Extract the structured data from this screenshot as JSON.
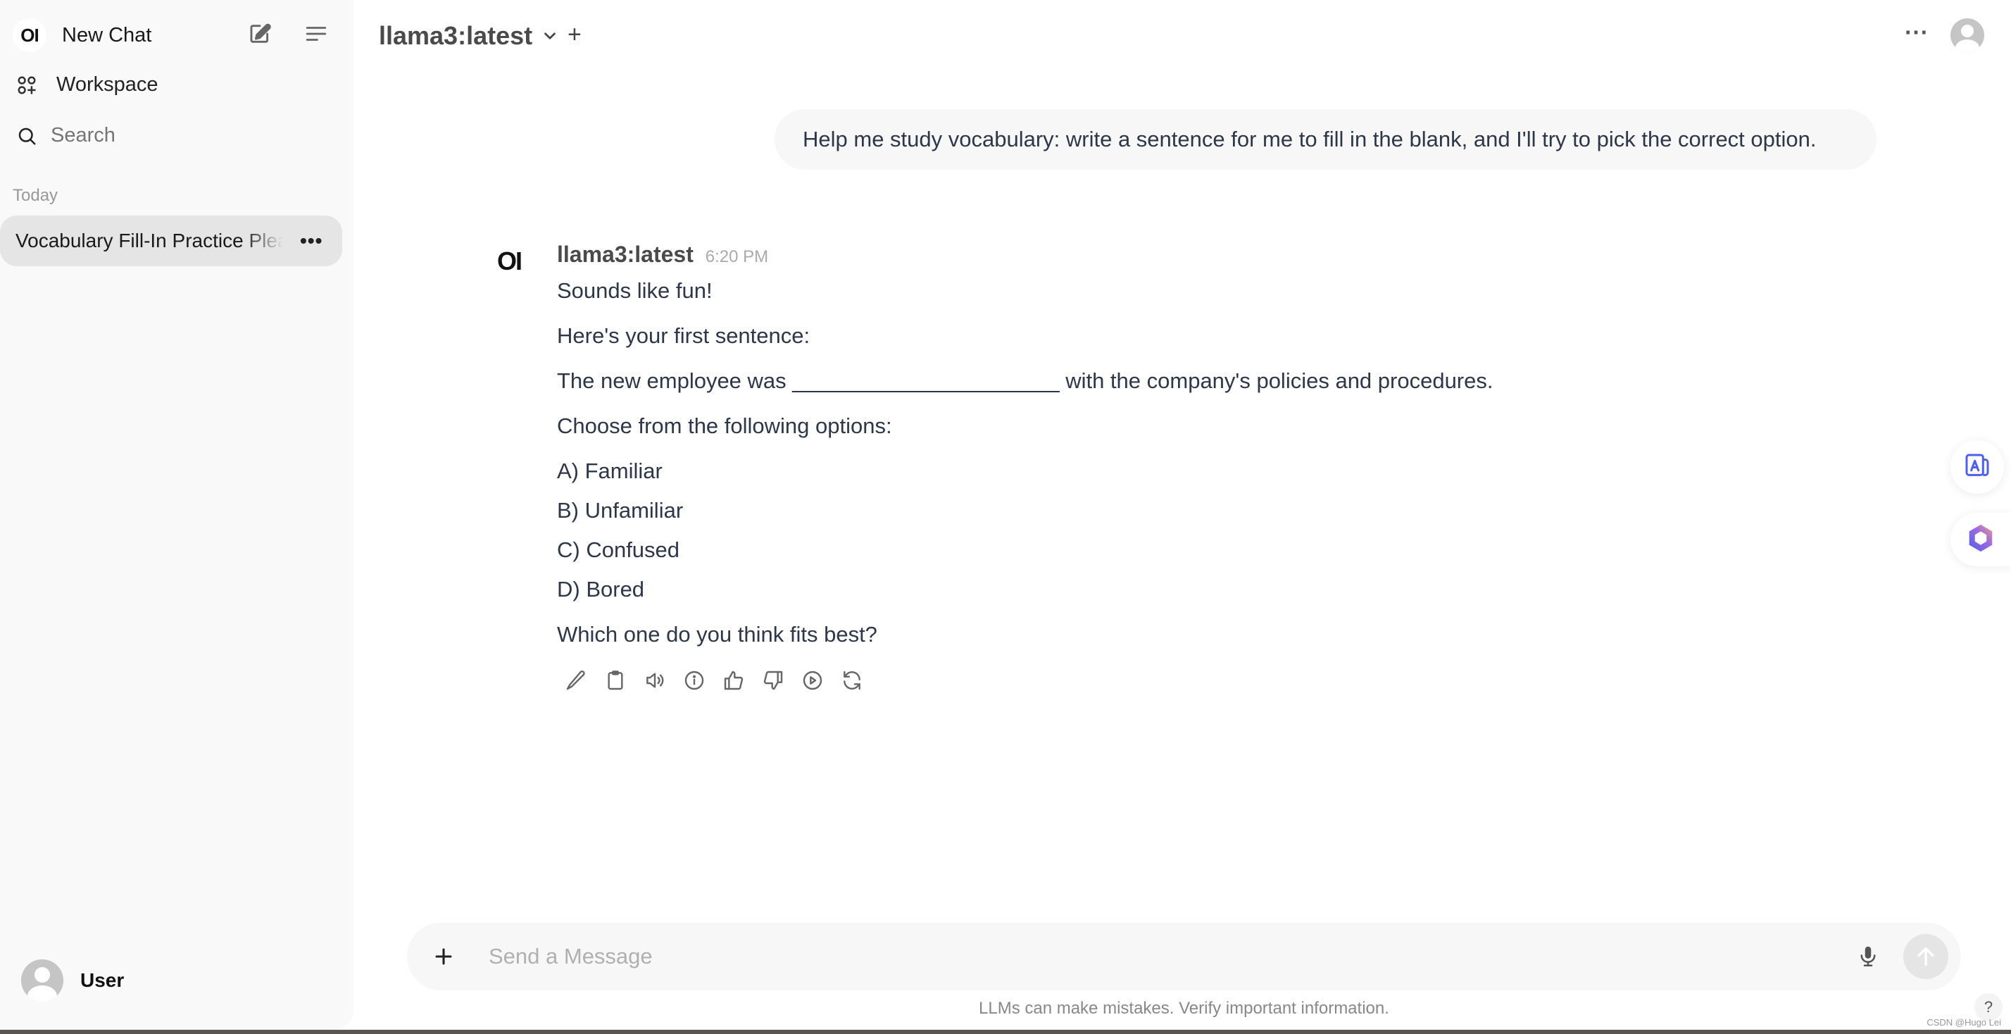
{
  "sidebar": {
    "logo_text": "OI",
    "new_chat_label": "New Chat",
    "workspace_label": "Workspace",
    "search_placeholder": "Search",
    "section_label": "Today",
    "chats": [
      {
        "title": "Vocabulary Fill-In Practice Please"
      }
    ],
    "user_name": "User"
  },
  "header": {
    "model_name": "llama3:latest",
    "add_label": "+",
    "more_label": "⋯"
  },
  "conversation": {
    "user_message": "Help me study vocabulary: write a sentence for me to fill in the blank, and I'll try to pick the correct option.",
    "assistant": {
      "logo_text": "OI",
      "name": "llama3:latest",
      "time": "6:20 PM",
      "lines": {
        "greeting": "Sounds like fun!",
        "intro": "Here's your first sentence:",
        "sentence": "The new employee was ______________________ with the company's policies and procedures.",
        "prompt": "Choose from the following options:",
        "options": [
          "A) Familiar",
          "B) Unfamiliar",
          "C) Confused",
          "D) Bored"
        ],
        "question": "Which one do you think fits best?"
      },
      "actions": [
        "edit-icon",
        "copy-icon",
        "read-aloud-icon",
        "info-icon",
        "thumbs-up-icon",
        "thumbs-down-icon",
        "continue-icon",
        "regenerate-icon"
      ]
    }
  },
  "input": {
    "placeholder": "Send a Message",
    "value": ""
  },
  "footer": {
    "disclaimer": "LLMs can make mistakes. Verify important information.",
    "help_label": "?",
    "watermark": "CSDN @Hugo Lei"
  },
  "colors": {
    "sidebar_bg": "#f9f9f9",
    "selected_chat_bg": "#e5e5e5",
    "bubble_bg": "#f7f7f8",
    "text": "#2d3748",
    "muted": "#888888",
    "translate_accent": "#4f5fe8"
  }
}
